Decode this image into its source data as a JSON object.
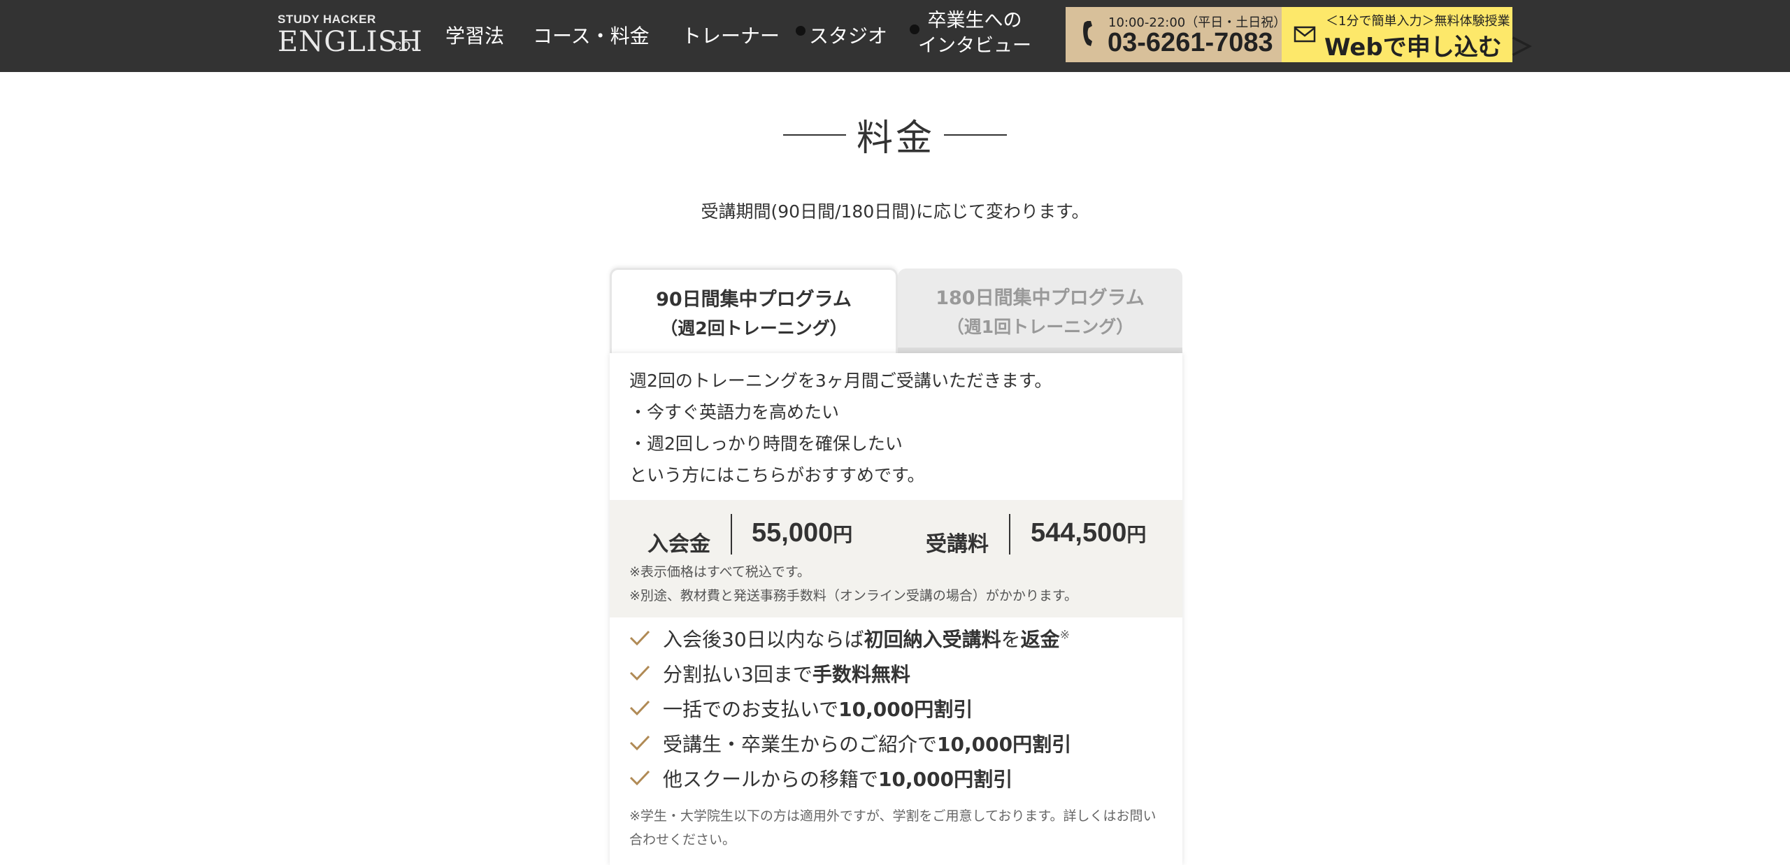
{
  "header": {
    "logo_top": "STUDY HACKER",
    "logo_main": "ENGLISH",
    "logo_co": "co.",
    "nav": [
      {
        "label": "学習法"
      },
      {
        "label": "コース・料金"
      },
      {
        "label": "トレーナー"
      },
      {
        "label": "スタジオ"
      },
      {
        "label_line1": "卒業生への",
        "label_line2": "インタビュー"
      }
    ],
    "phone": {
      "hours": "10:00-22:00（平日・土日祝）",
      "number": "03-6261-7083",
      "icon": "phone-icon"
    },
    "web": {
      "sub": "＜1分で簡単入力＞無料体験授業",
      "main": "Webで申し込む ＞",
      "icon": "mail-icon"
    },
    "colors": {
      "bar": "#333333",
      "phone_bg": "#d8c09a",
      "web_bg": "#fde86a"
    }
  },
  "section": {
    "title": "料金",
    "subtitle": "受講期間(90日間/180日間)に応じて変わります。"
  },
  "tabs": [
    {
      "line1": "90日間集中プログラム",
      "line2": "（週2回トレーニング）",
      "active": true
    },
    {
      "line1": "180日間集中プログラム",
      "line2": "（週1回トレーニング）",
      "active": false
    }
  ],
  "panel": {
    "description": [
      "週2回のトレーニングを3ヶ月間ご受講いただきます。",
      "・今すぐ英語力を高めたい",
      "・週2回しっかり時間を確保したい",
      "という方にはこちらがおすすめです。"
    ],
    "prices": {
      "entry_label": "入会金",
      "entry_value": "55,000",
      "tuition_label": "受講料",
      "tuition_value": "544,500",
      "unit": "円",
      "notes": [
        "※表示価格はすべて税込です。",
        "※別途、教材費と発送事務手数料（オンライン受講の場合）がかかります。"
      ]
    },
    "benefits": [
      {
        "parts": [
          [
            "入会後30日以内ならば",
            false
          ],
          [
            "初回納入受講料",
            true
          ],
          [
            "を",
            false
          ],
          [
            "返金",
            true
          ]
        ],
        "asterisk": "※"
      },
      {
        "parts": [
          [
            "分割払い3回まで",
            false
          ],
          [
            "手数料無料",
            true
          ]
        ]
      },
      {
        "parts": [
          [
            "一括でのお支払いで",
            false
          ],
          [
            "10,000円割引",
            true
          ]
        ]
      },
      {
        "parts": [
          [
            "受講生・卒業生からのご紹介で",
            false
          ],
          [
            "10,000円割引",
            true
          ]
        ]
      },
      {
        "parts": [
          [
            "他スクールからの移籍で",
            false
          ],
          [
            "10,000円割引",
            true
          ]
        ]
      }
    ],
    "footnote": "※学生・大学院生以下の方は適用外ですが、学割をご用意しております。詳しくはお問い合わせください。",
    "check_color": "#b08a55"
  }
}
